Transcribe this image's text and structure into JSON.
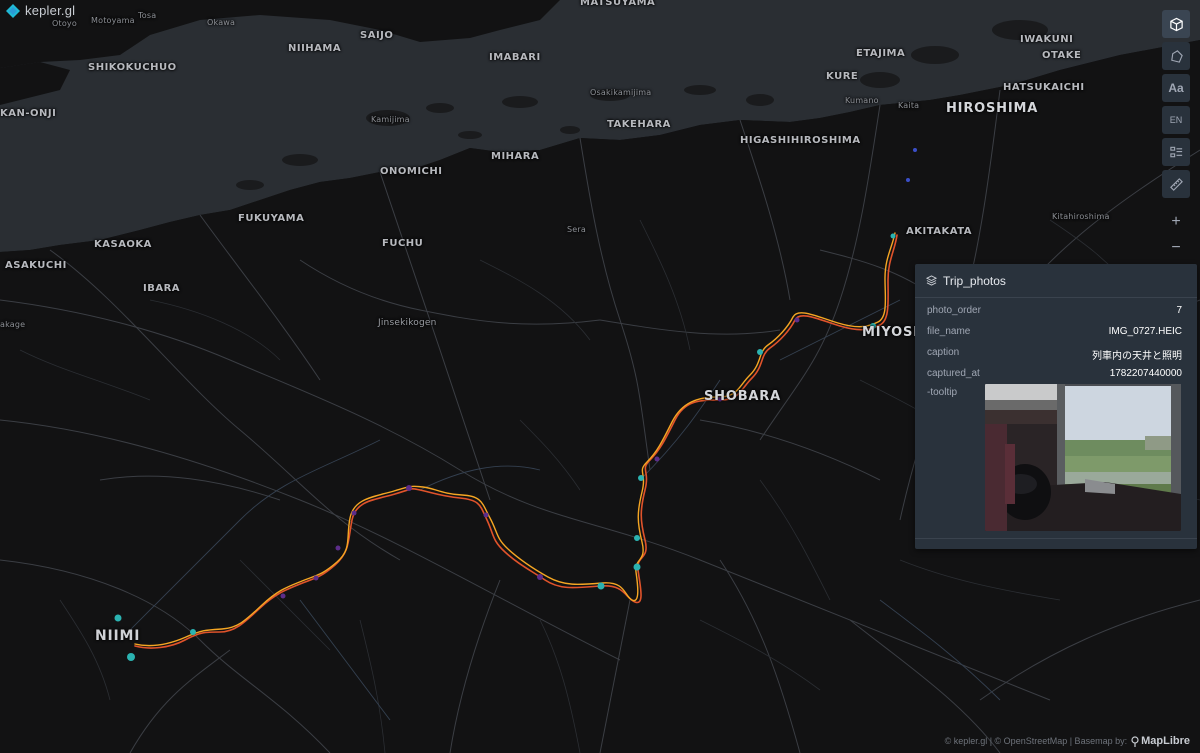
{
  "app": {
    "logo_text": "kepler.gl"
  },
  "map": {
    "route_colors": [
      "#f5a623",
      "#e0532b",
      "#a01f3a",
      "#5c2d8a",
      "#2bb3b1"
    ],
    "place_labels": {
      "otoyo": "Otoyo",
      "motoyama": "Motoyama",
      "tosa": "Tosa",
      "okawa": "Okawa",
      "matsuyama": "MATSUYAMA",
      "niihama": "NIIHAMA",
      "saijo": "SAIJO",
      "imabari": "IMABARI",
      "shikokuchuo": "SHIKOKUCHUO",
      "kan_onji": "KAN-ONJI",
      "kamijima": "Kamijima",
      "osakikamijima": "Osakikamijima",
      "takehara": "TAKEHARA",
      "etajima": "ETAJIMA",
      "kure": "KURE",
      "kumano": "Kumano",
      "kaita": "Kaita",
      "iwakuni": "IWAKUNI",
      "otake": "OTAKE",
      "hatsukaichi": "HATSUKAICHI",
      "hiroshima": "HIROSHIMA",
      "higashihiroshima": "HIGASHIHIROSHIMA",
      "mihara": "MIHARA",
      "onomichi": "ONOMICHI",
      "fukuyama": "FUKUYAMA",
      "kasaoka": "KASAOKA",
      "fuchu": "FUCHU",
      "sera": "Sera",
      "asakuchi": "ASAKUCHI",
      "ibara": "IBARA",
      "kitahiroshima": "Kitahiroshima",
      "akitakata": "AKITAKATA",
      "miyoshi": "MIYOSHI",
      "jinsekikogen": "Jinsekikogen",
      "kake": "akage",
      "shobara": "SHOBARA",
      "niimi": "NIIMI"
    }
  },
  "toolbar": {
    "items": [
      {
        "name": "3d-view-button",
        "icon": "cube-icon",
        "active": true
      },
      {
        "name": "draw-polygon-button",
        "icon": "polygon-icon",
        "active": false
      },
      {
        "name": "map-labels-button",
        "icon": "text-icon",
        "label": "Aa",
        "active": false
      },
      {
        "name": "locale-button",
        "icon": "language-icon",
        "label": "EN",
        "active": false
      },
      {
        "name": "legend-button",
        "icon": "legend-icon",
        "active": false
      },
      {
        "name": "split-map-button",
        "icon": "split-icon",
        "active": false
      },
      {
        "name": "zoom-in-button",
        "icon": "plus-icon",
        "label": "+",
        "active": false
      },
      {
        "name": "zoom-out-button",
        "icon": "minus-icon",
        "label": "−",
        "active": false
      }
    ]
  },
  "tooltip": {
    "layer_name": "Trip_photos",
    "rows": [
      {
        "key": "photo_order",
        "value": "7"
      },
      {
        "key": "file_name",
        "value": "IMG_0727.HEIC"
      },
      {
        "key": "caption",
        "value": "列車内の天井と照明"
      },
      {
        "key": "captured_at",
        "value": "1782207440000"
      },
      {
        "key": "-tooltip",
        "value": ""
      }
    ]
  },
  "attribution": {
    "text": "© kepler.gl | © OpenStreetMap | Basemap by:",
    "maplibre": "MapLibre"
  }
}
